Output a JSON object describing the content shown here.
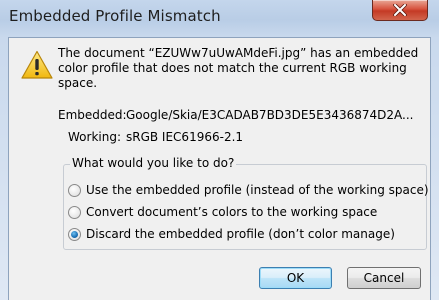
{
  "window": {
    "title": "Embedded Profile Mismatch"
  },
  "message": {
    "text": "The document “EZUWw7uUwAMdeFi.jpg” has an embedded color profile that does not match the current RGB working space."
  },
  "profiles": {
    "embedded_label": "Embedded:",
    "embedded_value": "Google/Skia/E3CADAB7BD3DE5E3436874D2A...",
    "working_label": "Working:",
    "working_value": "sRGB IEC61966-2.1"
  },
  "question": {
    "label": "What would you like to do?",
    "options": [
      {
        "label": "Use the embedded profile (instead of the working space)",
        "selected": false
      },
      {
        "label": "Convert document’s colors to the working space",
        "selected": false
      },
      {
        "label": "Discard the embedded profile (don’t color manage)",
        "selected": true
      }
    ]
  },
  "buttons": {
    "ok_label": "OK",
    "cancel_label": "Cancel"
  },
  "icons": {
    "warning": "warning-icon",
    "close": "close-icon"
  },
  "colors": {
    "close_button": "#c43a25",
    "warning_yellow": "#f4c21d",
    "default_button_border": "#3c7fb1",
    "radio_selected": "#1a6fb5"
  }
}
